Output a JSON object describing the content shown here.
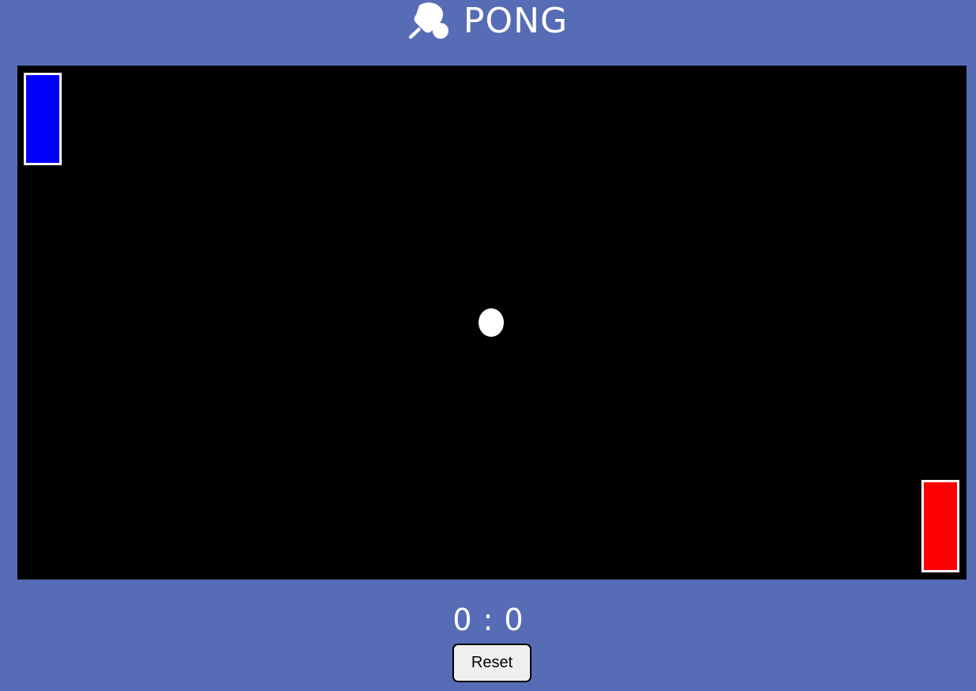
{
  "header": {
    "title": "PONG",
    "logo_icon": "ping-pong-paddle-ball-icon"
  },
  "game": {
    "background_color": "#000000",
    "left_paddle": {
      "color": "#0000ff",
      "outline_color": "#ffffff"
    },
    "right_paddle": {
      "color": "#ff0000",
      "outline_color": "#ffffff"
    },
    "ball": {
      "color": "#ffffff"
    }
  },
  "score": {
    "left": "0",
    "separator": ":",
    "right": "0"
  },
  "controls": {
    "reset_label": "Reset"
  },
  "colors": {
    "page_background": "#566cb6",
    "text": "#ffffff"
  }
}
